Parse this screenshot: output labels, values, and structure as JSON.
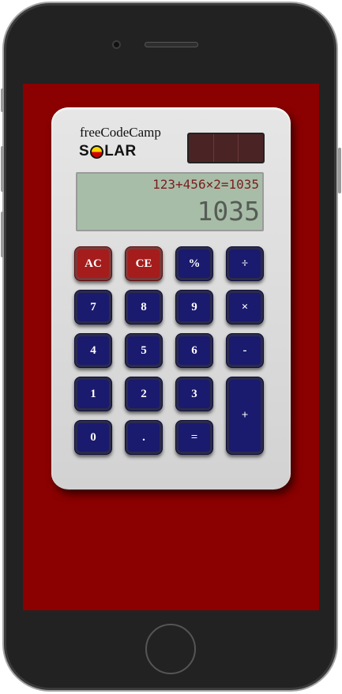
{
  "calculator": {
    "brand": "freeCodeCamp",
    "model_prefix": "S",
    "model_suffix": "LAR",
    "display": {
      "formula": "123+456×2=1035",
      "result": "1035"
    },
    "keys": {
      "ac": "AC",
      "ce": "CE",
      "percent": "%",
      "divide": "÷",
      "seven": "7",
      "eight": "8",
      "nine": "9",
      "multiply": "×",
      "four": "4",
      "five": "5",
      "six": "6",
      "minus": "-",
      "one": "1",
      "two": "2",
      "three": "3",
      "plus": "+",
      "zero": "0",
      "decimal": ".",
      "equals": "="
    }
  },
  "colors": {
    "screen_background": "#8b0000",
    "key_blue": "#1a1a6e",
    "key_red": "#a51c1c",
    "display_green": "#a8bda8"
  }
}
